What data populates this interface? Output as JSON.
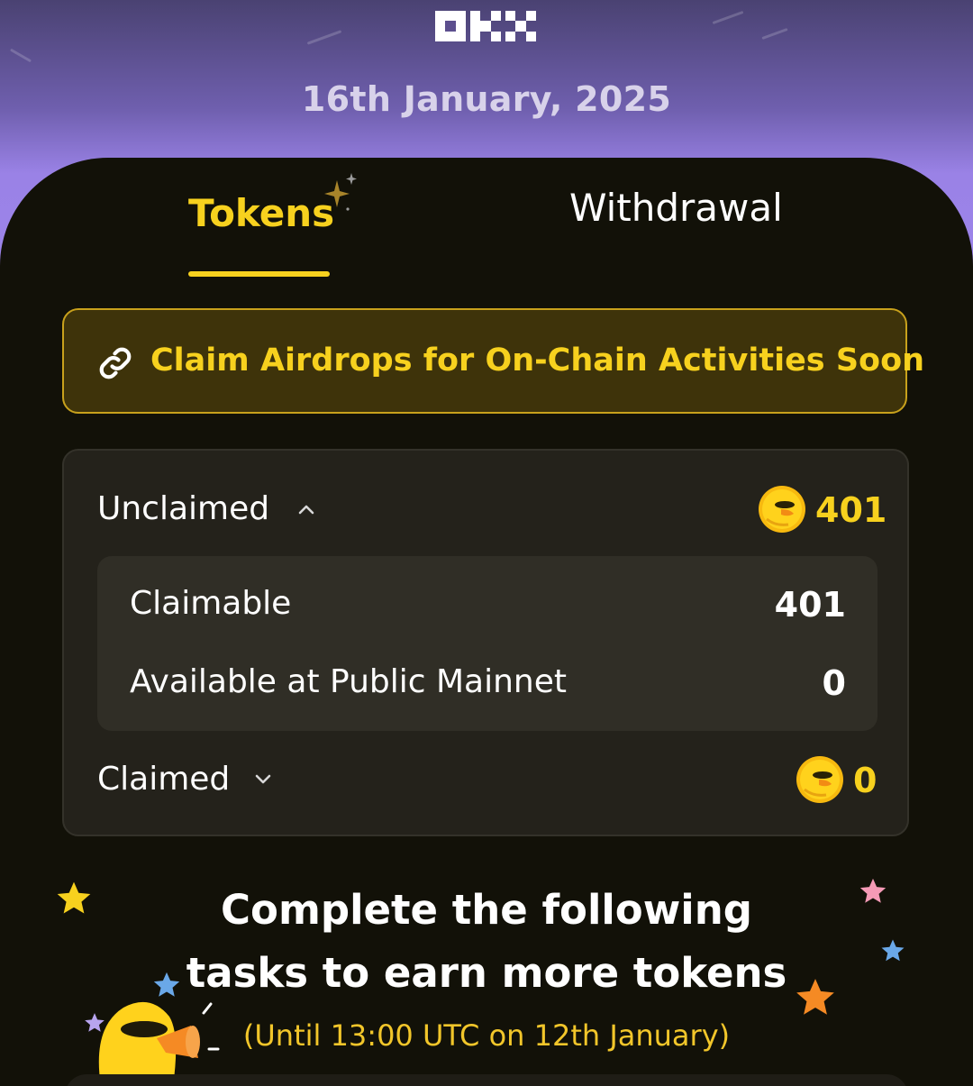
{
  "header": {
    "brand": "OKX",
    "date": "16th January, 2025"
  },
  "tabs": [
    {
      "label": "Tokens",
      "active": true
    },
    {
      "label": "Withdrawal",
      "active": false
    }
  ],
  "banner": {
    "icon": "link-icon",
    "text": "Claim Airdrops for On-Chain Activities Soon"
  },
  "unclaimed": {
    "label": "Unclaimed",
    "icon": "chevron-up-icon",
    "coin_icon": "duck-coin-icon",
    "amount": "401",
    "details": [
      {
        "label": "Claimable",
        "value": "401"
      },
      {
        "label": "Available at Public Mainnet",
        "value": "0"
      }
    ]
  },
  "claimed": {
    "label": "Claimed",
    "icon": "chevron-down-icon",
    "coin_icon": "duck-coin-icon",
    "amount": "0"
  },
  "tasks": {
    "title_line1": "Complete the following",
    "title_line2": "tasks to earn more tokens",
    "deadline": "(Until 13:00 UTC on 12th January)"
  },
  "colors": {
    "accent": "#f7d11e",
    "panel": "#121108",
    "card": "#24221b",
    "header_purple": "#9b83e8"
  }
}
